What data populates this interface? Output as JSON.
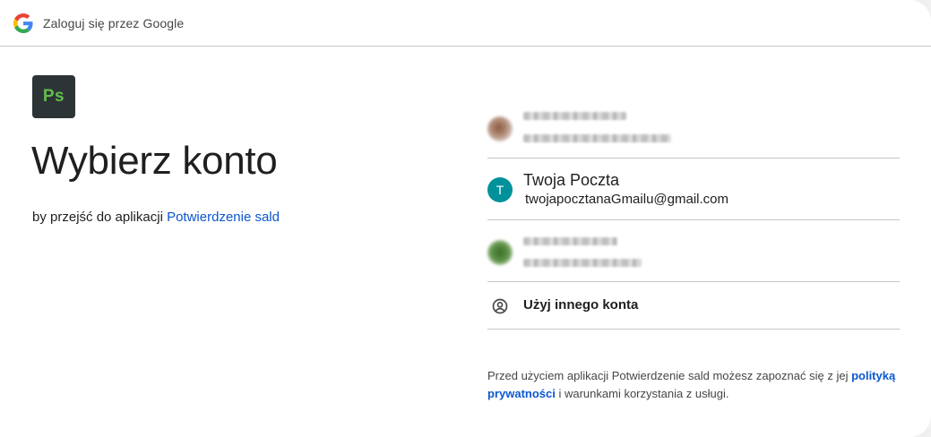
{
  "topbar": {
    "title": "Zaloguj się przez Google",
    "logo_icon": "google-g-icon"
  },
  "app": {
    "icon_text": "Ps",
    "icon_bg": "#2d3436",
    "icon_fg": "#5fbf4e"
  },
  "main": {
    "headline": "Wybierz konto",
    "subtitle_prefix": "by przejść do aplikacji ",
    "app_name": "Potwierdzenie sald"
  },
  "accounts": {
    "items": [
      {
        "kind": "blurred",
        "avatar": "photo-avatar"
      },
      {
        "kind": "named",
        "initial": "T",
        "name": "Twoja Poczta",
        "email": "twojapocztanaGmailu@gmail.com",
        "avatar_color": "#00919a"
      },
      {
        "kind": "blurred",
        "avatar": "photo-avatar"
      }
    ],
    "other_label": "Użyj innego konta",
    "other_icon": "account-circle-icon"
  },
  "footer": {
    "text_prefix": "Przed użyciem aplikacji Potwierdzenie sald możesz zapoznać się z jej ",
    "policy_link": "polityką prywatności",
    "text_suffix": " i warunkami korzystania z usługi."
  },
  "colors": {
    "link": "#0b57d0",
    "divider": "#c4c7c5",
    "text": "#1f1f1f"
  }
}
